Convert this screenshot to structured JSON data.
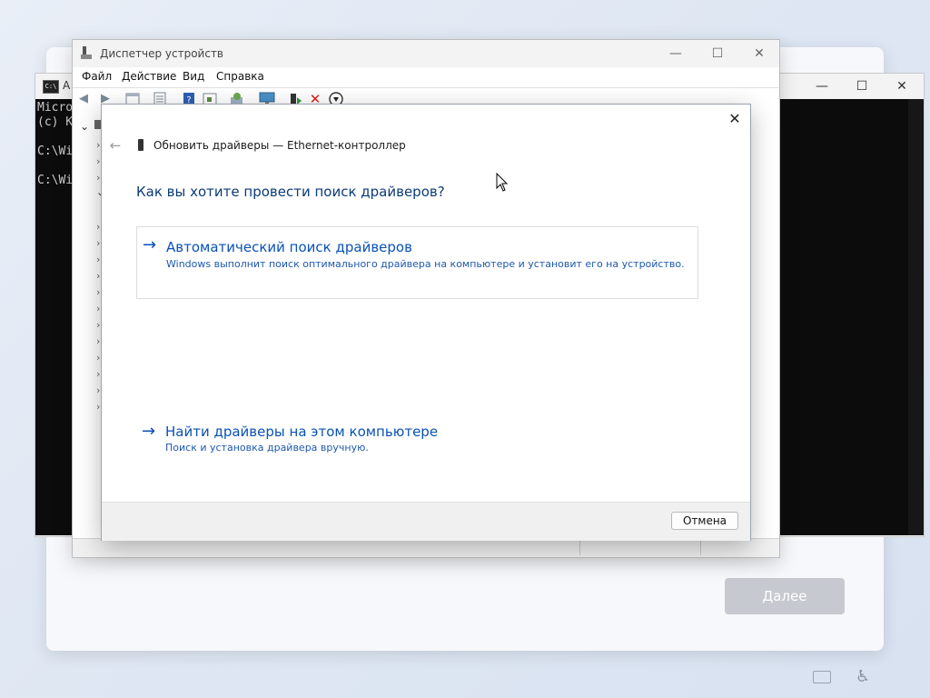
{
  "setup": {
    "next_label": "Далее"
  },
  "cmd": {
    "title": "А",
    "lines": [
      "Micro",
      "(c) К",
      "",
      "C:\\Wi",
      "",
      "C:\\Wi"
    ],
    "controls": [
      "—",
      "☐",
      "✕"
    ]
  },
  "device_manager": {
    "title": "Диспетчер устройств",
    "menu": [
      "Файл",
      "Действие",
      "Вид",
      "Справка"
    ],
    "controls": [
      "—",
      "☐",
      "✕"
    ],
    "tree_chevrons": [
      "⌄",
      "›",
      "›",
      "›",
      "⌄",
      "›",
      "›",
      "›",
      "›",
      "›",
      "›",
      "›",
      "›",
      "›",
      "›",
      "›",
      "›"
    ]
  },
  "dialog": {
    "title": "Обновить драйверы — Ethernet-контроллер",
    "question": "Как вы хотите провести поиск драйверов?",
    "option_auto": {
      "arrow": "→",
      "title": "Автоматический поиск драйверов",
      "description": "Windows выполнит поиск оптимального драйвера на компьютере и установит его на устройство."
    },
    "option_manual": {
      "arrow": "→",
      "title": "Найти драйверы на этом компьютере",
      "description": "Поиск и установка драйвера вручную."
    },
    "cancel_label": "Отмена",
    "close_glyph": "✕",
    "back_glyph": "←"
  },
  "icons": {
    "toolbar": [
      "back-icon",
      "forward-icon",
      "properties-icon",
      "view-icon",
      "help-icon",
      "show-hidden-icon",
      "scan-hardware-icon",
      "monitor-icon",
      "update-driver-icon",
      "uninstall-icon",
      "disable-icon"
    ]
  },
  "colors": {
    "accent_blue": "#0a52b5",
    "heading_blue": "#0b3b7a",
    "danger_red": "#d81e1e"
  }
}
